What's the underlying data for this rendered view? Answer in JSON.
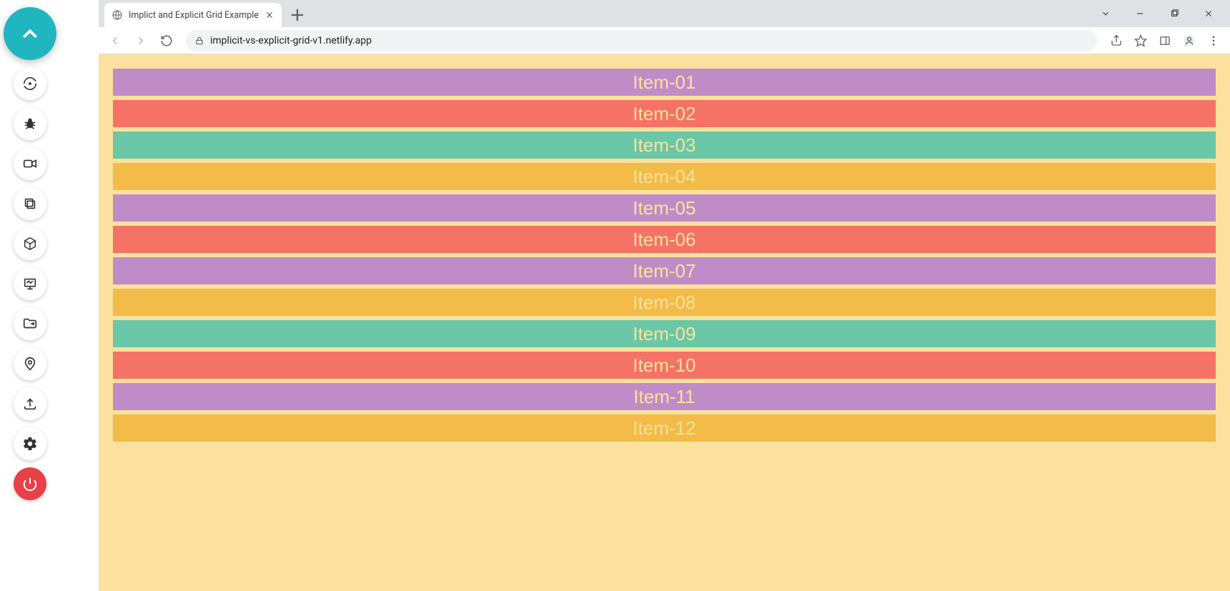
{
  "tab": {
    "title": "Implict and Explicit Grid Example"
  },
  "url": "implicit-vs-explicit-grid-v1.netlify.app",
  "items": [
    {
      "label": "Item-01",
      "color": "c-purple"
    },
    {
      "label": "Item-02",
      "color": "c-coral"
    },
    {
      "label": "Item-03",
      "color": "c-teal"
    },
    {
      "label": "Item-04",
      "color": "c-gold"
    },
    {
      "label": "Item-05",
      "color": "c-purple"
    },
    {
      "label": "Item-06",
      "color": "c-coral"
    },
    {
      "label": "Item-07",
      "color": "c-purple"
    },
    {
      "label": "Item-08",
      "color": "c-gold"
    },
    {
      "label": "Item-09",
      "color": "c-teal"
    },
    {
      "label": "Item-10",
      "color": "c-coral"
    },
    {
      "label": "Item-11",
      "color": "c-purple"
    },
    {
      "label": "Item-12",
      "color": "c-gold"
    }
  ]
}
